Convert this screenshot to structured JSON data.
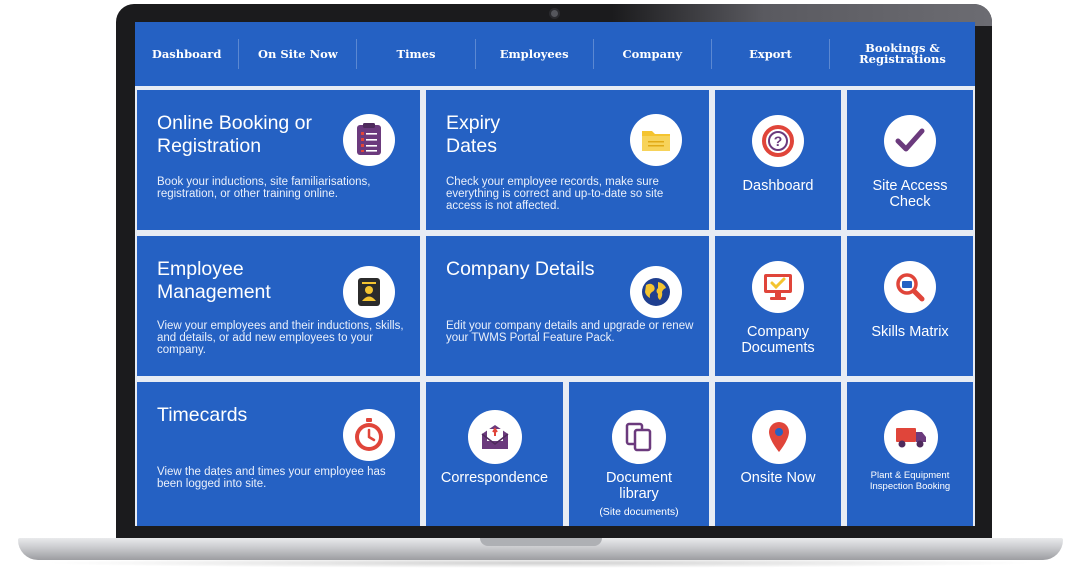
{
  "nav": {
    "items": [
      {
        "label": "Dashboard"
      },
      {
        "label": "On Site Now"
      },
      {
        "label": "Times"
      },
      {
        "label": "Employees"
      },
      {
        "label": "Company"
      },
      {
        "label": "Export"
      },
      {
        "label": "Bookings &\nRegistrations"
      }
    ]
  },
  "tiles": {
    "online_booking": {
      "title": "Online Booking or Registration",
      "desc": "Book your inductions, site familiarisations, registration, or other training online.",
      "icon": "clipboard-list-icon"
    },
    "expiry_dates": {
      "title": "Expiry Dates",
      "desc": "Check your employee records, make sure everything is correct and up-to-date so site access is not affected.",
      "icon": "folder-icon"
    },
    "dashboard": {
      "label": "Dashboard",
      "icon": "question-icon"
    },
    "site_access": {
      "label": "Site Access Check",
      "icon": "checkmark-icon"
    },
    "employee_mgmt": {
      "title": "Employee Management",
      "desc": "View your employees and their inductions, skills, and details, or add new employees to your company.",
      "icon": "id-card-icon"
    },
    "company_details": {
      "title": "Company Details",
      "desc": "Edit your company details and upgrade or renew your TWMS Portal Feature Pack.",
      "icon": "globe-icon"
    },
    "company_docs": {
      "label": "Company Documents",
      "icon": "monitor-check-icon"
    },
    "skills_matrix": {
      "label": "Skills Matrix",
      "icon": "magnifier-icon"
    },
    "timecards": {
      "title": "Timecards",
      "desc": "View the dates and times your employee has been logged into site.",
      "icon": "stopwatch-icon"
    },
    "correspondence": {
      "label": "Correspondence",
      "icon": "envelope-icon"
    },
    "document_library": {
      "label": "Document library",
      "sublabel": "(Site documents)",
      "icon": "documents-icon"
    },
    "onsite_now": {
      "label": "Onsite Now",
      "icon": "location-pin-icon"
    },
    "plant_equipment": {
      "label": "Plant & Equipment Inspection Booking",
      "icon": "truck-icon"
    }
  },
  "colors": {
    "tile_blue": "#2561c3",
    "icon_purple": "#6b3a7d",
    "icon_red": "#e0453a",
    "icon_yellow": "#f4c430"
  }
}
